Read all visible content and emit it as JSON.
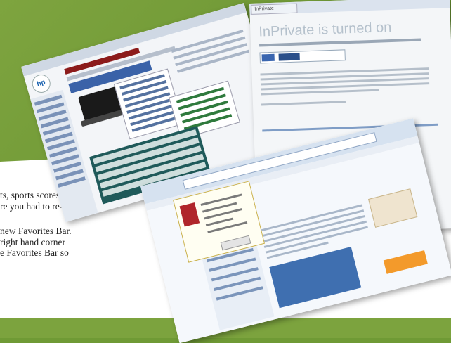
{
  "article": {
    "lines": [
      "ts, sports scores,",
      "re you had to re-",
      "",
      "new Favorites Bar.",
      "right hand corner",
      "e Favorites Bar so"
    ]
  },
  "shots": {
    "hp": {
      "logo": "hp"
    },
    "inprivate": {
      "tab_label": "InPrivate",
      "heading": "InPrivate is turned on"
    }
  },
  "colors": {
    "background": "#6f9a35",
    "inprivate_heading": "#b5c1cc"
  }
}
